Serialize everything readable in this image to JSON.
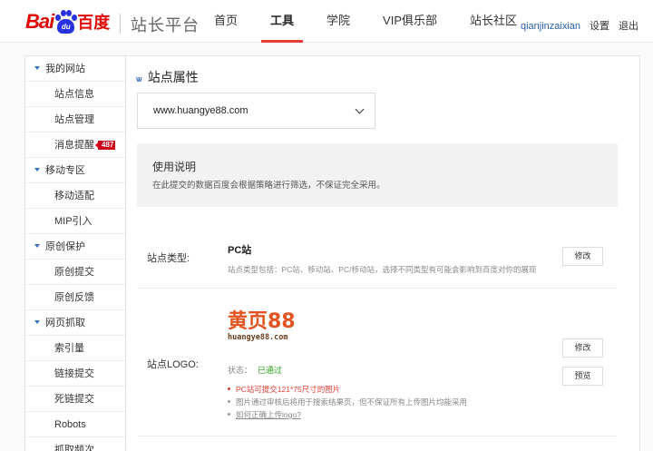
{
  "header": {
    "logo_bai": "Bai",
    "logo_du": "du",
    "logo_cn": "百度",
    "site_name": "站长平台",
    "brand_color": "#e10602",
    "nav": [
      {
        "label": "首页",
        "active": false
      },
      {
        "label": "工具",
        "active": true
      },
      {
        "label": "学院",
        "active": false
      },
      {
        "label": "VIP俱乐部",
        "active": false
      },
      {
        "label": "站长社区",
        "active": false
      }
    ],
    "username": "qianjinzaixian",
    "settings_label": "设置",
    "logout_label": "退出"
  },
  "sidebar": {
    "groups": [
      {
        "label": "我的网站",
        "items": [
          {
            "label": "站点信息"
          },
          {
            "label": "站点管理"
          },
          {
            "label": "消息提醒",
            "badge": "487"
          }
        ]
      },
      {
        "label": "移动专区",
        "items": [
          {
            "label": "移动适配"
          },
          {
            "label": "MIP引入"
          }
        ]
      },
      {
        "label": "原创保护",
        "items": [
          {
            "label": "原创提交"
          },
          {
            "label": "原创反馈"
          }
        ]
      },
      {
        "label": "网页抓取",
        "items": [
          {
            "label": "索引量"
          },
          {
            "label": "链接提交"
          },
          {
            "label": "死链提交"
          },
          {
            "label": "Robots"
          },
          {
            "label": "抓取频次"
          }
        ]
      }
    ]
  },
  "main": {
    "title": "站点属性",
    "site_select": {
      "value": "www.huangye88.com"
    },
    "info": {
      "heading": "使用说明",
      "text": "在此提交的数据百度会根据策略进行筛选，不保证完全采用。"
    },
    "site_type": {
      "label": "站点类型:",
      "value": "PC站",
      "desc": "站点类型包括：PC站、移动站、PC/移动站，选择不同类型有可能会影响到百度对你的展现",
      "edit_label": "修改"
    },
    "site_logo": {
      "label": "站点LOGO:",
      "logo_text_big": "黄页88",
      "logo_text_small": "huangye88.com",
      "status_label": "状态：",
      "status_value": "已通过",
      "notes": [
        "PC站可提交121*75尺寸的图片",
        "图片通过审核后将用于搜索结果页，但不保证所有上传图片均能采用",
        "如何正确上传logo?"
      ],
      "edit_label": "修改",
      "preview_label": "预览"
    }
  }
}
